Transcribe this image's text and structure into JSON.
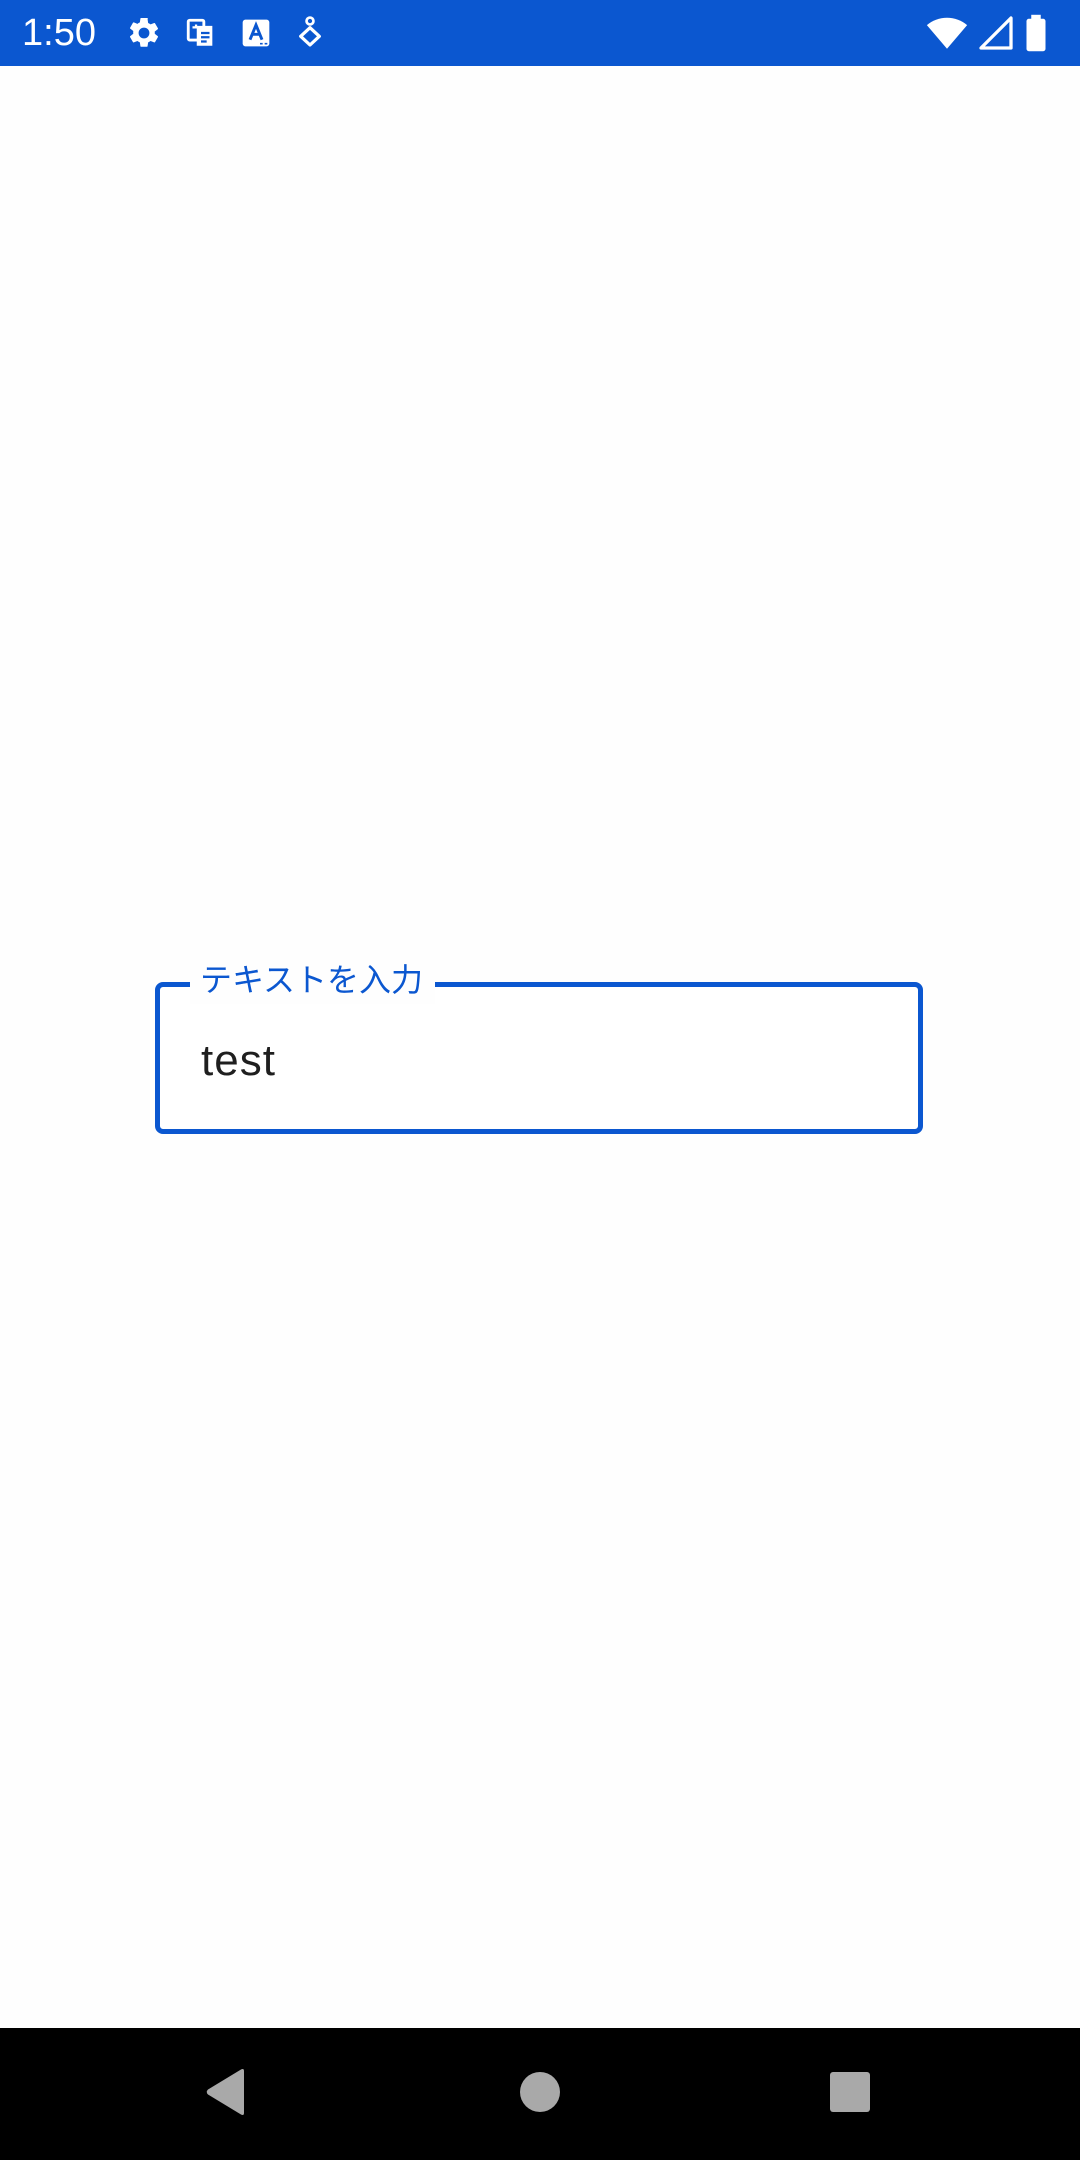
{
  "status_bar": {
    "time": "1:50",
    "background": "#0b57d0",
    "left_icons": [
      "settings-icon",
      "translate-icon",
      "font-a-icon",
      "accessibility-icon"
    ],
    "right_icons": [
      "wifi-icon",
      "cell-signal-icon",
      "battery-icon"
    ]
  },
  "text_field": {
    "label": "テキストを入力",
    "value": "test",
    "accent": "#0b57d0"
  },
  "nav_bar": {
    "buttons": [
      "back-icon",
      "home-icon",
      "recents-icon"
    ]
  }
}
